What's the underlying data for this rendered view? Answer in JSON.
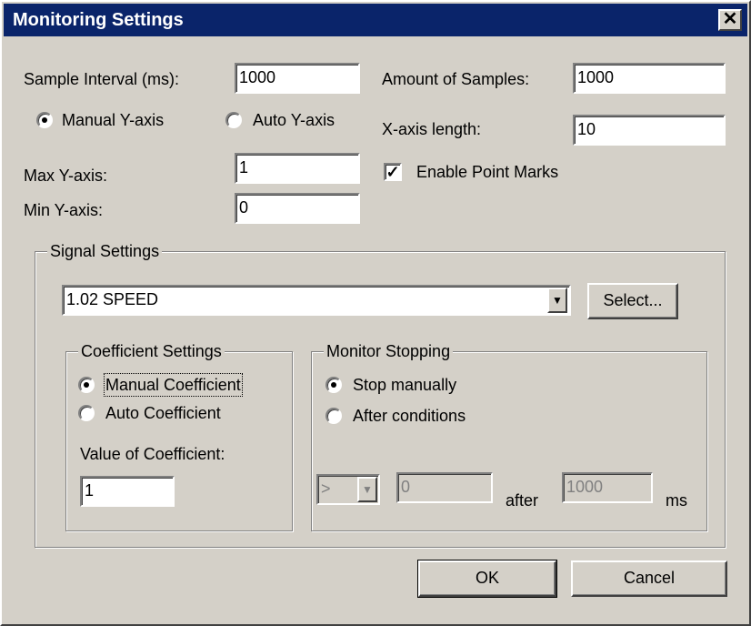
{
  "window": {
    "title": "Monitoring Settings",
    "close_glyph": "✕"
  },
  "sample_interval": {
    "label": "Sample Interval (ms):",
    "value": "1000"
  },
  "amount_of_samples": {
    "label": "Amount of Samples:",
    "value": "1000"
  },
  "y_axis_mode": {
    "manual_label": "Manual Y-axis",
    "auto_label": "Auto Y-axis",
    "selected": "manual"
  },
  "x_axis_length": {
    "label": "X-axis length:",
    "value": "10"
  },
  "max_y_axis": {
    "label": "Max Y-axis:",
    "value": "1"
  },
  "min_y_axis": {
    "label": "Min Y-axis:",
    "value": "0"
  },
  "point_marks": {
    "label": "Enable Point Marks",
    "checked": true,
    "check_glyph": "✓"
  },
  "signal_settings": {
    "title": "Signal Settings",
    "signal_value": "1.02  SPEED",
    "select_button": "Select...",
    "dropdown_glyph": "▼"
  },
  "coefficient_settings": {
    "title": "Coefficient Settings",
    "manual_label": "Manual Coefficient",
    "auto_label": "Auto Coefficient",
    "selected": "manual",
    "value_label": "Value of Coefficient:",
    "value": "1"
  },
  "monitor_stopping": {
    "title": "Monitor Stopping",
    "stop_manually_label": "Stop manually",
    "after_conditions_label": "After conditions",
    "selected": "stop_manually",
    "operator_value": ">",
    "threshold_value": "0",
    "after_label": "after",
    "time_value": "1000",
    "ms_label": "ms"
  },
  "buttons": {
    "ok": "OK",
    "cancel": "Cancel"
  }
}
